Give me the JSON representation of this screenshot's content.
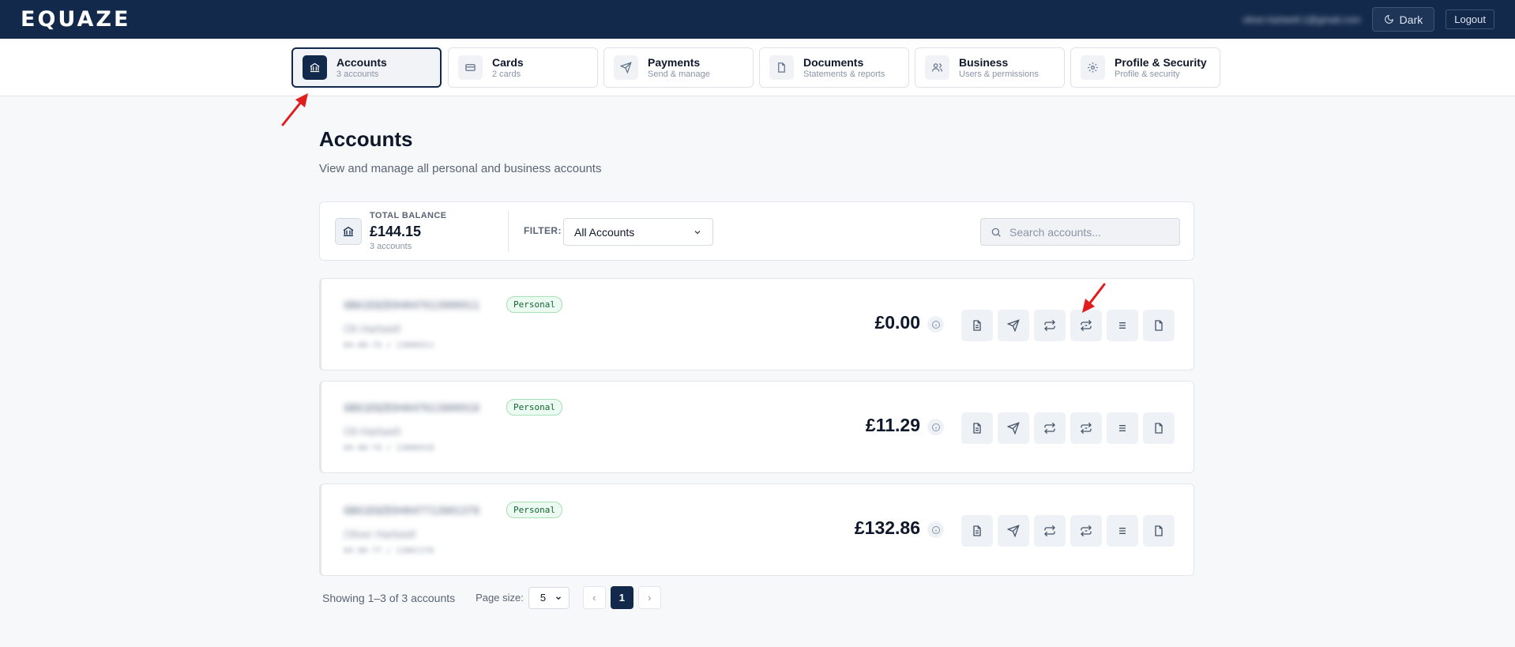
{
  "app": {
    "logo": "EQUAZE"
  },
  "header": {
    "user_email": "oliver.hartwell.1@gmail.com",
    "dark_label": "Dark",
    "logout_label": "Logout"
  },
  "nav": {
    "tabs": [
      {
        "title": "Accounts",
        "sub": "3 accounts",
        "icon": "bank-icon",
        "active": true
      },
      {
        "title": "Cards",
        "sub": "2 cards",
        "icon": "card-icon"
      },
      {
        "title": "Payments",
        "sub": "Send & manage",
        "icon": "send-icon"
      },
      {
        "title": "Documents",
        "sub": "Statements & reports",
        "icon": "document-icon"
      },
      {
        "title": "Business",
        "sub": "Users & permissions",
        "icon": "users-icon"
      },
      {
        "title": "Profile & Security",
        "sub": "Profile & security",
        "icon": "gear-icon"
      }
    ]
  },
  "page": {
    "title": "Accounts",
    "subtitle": "View and manage all personal and business accounts"
  },
  "summary": {
    "label": "TOTAL BALANCE",
    "amount": "£144.15",
    "count": "3 accounts",
    "filter_label": "FILTER:",
    "filter_value": "All Accounts",
    "search_placeholder": "Search accounts..."
  },
  "accounts": [
    {
      "iban": "GB61EQZE04047613800911",
      "badge": "Personal",
      "name": "Oli Hartwell",
      "sort": "04-00-74 / 13800911",
      "balance": "£0.00"
    },
    {
      "iban": "GB61EQZE04047613800918",
      "badge": "Personal",
      "name": "Oli Hartwell",
      "sort": "04-00-74 / 13800918",
      "balance": "£11.29"
    },
    {
      "iban": "GB61EQZE04047713801378",
      "badge": "Personal",
      "name": "Oliver Hartwell",
      "sort": "04-00-77 / 13801378",
      "balance": "£132.86"
    }
  ],
  "pagination": {
    "showing": "Showing 1–3 of 3 accounts",
    "page_size_label": "Page size:",
    "page_size": "5",
    "prev": "‹",
    "current": "1",
    "next": "›"
  },
  "colors": {
    "primary": "#13294b",
    "badge_green": "#166534",
    "annotation_red": "#e11d1d"
  }
}
